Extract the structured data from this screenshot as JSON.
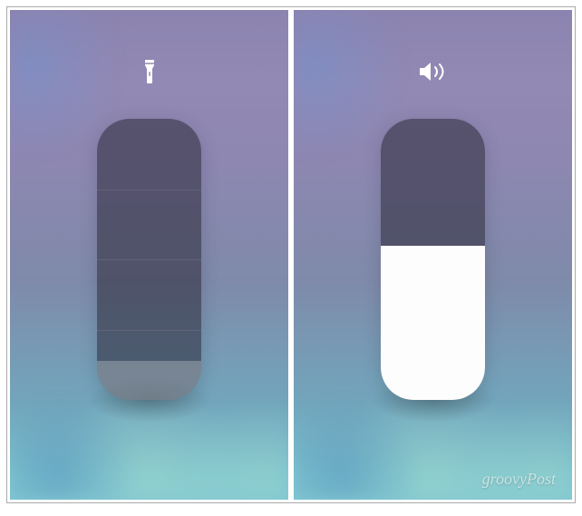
{
  "panels": {
    "left": {
      "icon": "flashlight-icon",
      "slider": {
        "type": "stepped",
        "steps": 4,
        "value": 0,
        "fill_percent": 14
      }
    },
    "right": {
      "icon": "volume-icon",
      "slider": {
        "type": "continuous",
        "value": 55,
        "fill_percent": 55
      }
    }
  },
  "watermark": "groovyPost",
  "colors": {
    "slider_bg": "rgba(40,38,52,0.55)",
    "slider_fill": "#fdfdfd",
    "icon": "#ffffff"
  }
}
